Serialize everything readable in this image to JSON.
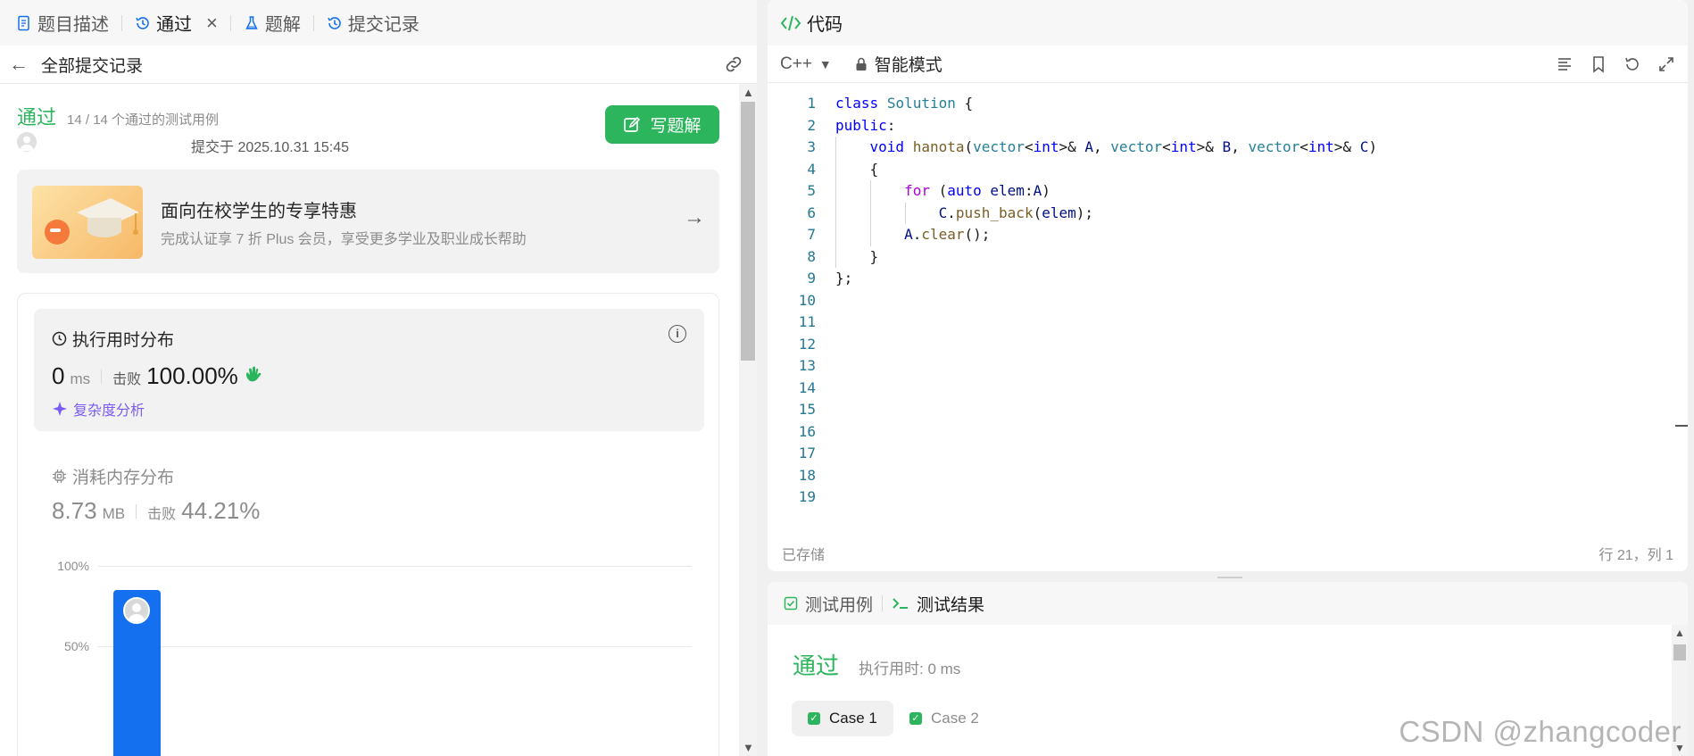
{
  "left": {
    "tabs": [
      {
        "label": "题目描述",
        "icon": "document-icon"
      },
      {
        "label": "通过",
        "icon": "history-icon",
        "active": true,
        "closable": true
      },
      {
        "label": "题解",
        "icon": "flask-icon"
      },
      {
        "label": "提交记录",
        "icon": "history-icon"
      }
    ],
    "back_label": "全部提交记录",
    "status": "通过",
    "status_detail": "14 / 14 个通过的测试用例",
    "submitted_at": "提交于 2025.10.31 15:45",
    "write_solution_label": "写题解",
    "promo": {
      "title": "面向在校学生的专享特惠",
      "subtitle": "完成认证享 7 折 Plus 会员，享受更多学业及职业成长帮助"
    },
    "runtime": {
      "title": "执行用时分布",
      "value": "0",
      "unit": "ms",
      "beat_label": "击败",
      "beat_value": "100.00%",
      "complexity_link": "复杂度分析"
    },
    "memory": {
      "title": "消耗内存分布",
      "value": "8.73",
      "unit": "MB",
      "beat_label": "击败",
      "beat_value": "44.21%"
    }
  },
  "chart_data": {
    "type": "bar",
    "y_ticks": [
      "100%",
      "50%"
    ],
    "ylim": [
      0,
      100
    ],
    "bars": [
      {
        "value": 85,
        "highlighted": true
      }
    ]
  },
  "code": {
    "title": "代码",
    "language": "C++",
    "mode": "智能模式",
    "line_numbers": [
      "1",
      "2",
      "3",
      "4",
      "5",
      "6",
      "7",
      "8",
      "9",
      "10",
      "11",
      "12",
      "13",
      "14",
      "15",
      "16",
      "17",
      "18",
      "19"
    ],
    "saved_status": "已存储",
    "cursor_position": "行 21，列 1"
  },
  "tests": {
    "tabs": [
      {
        "label": "测试用例"
      },
      {
        "label": "测试结果",
        "active": true
      }
    ],
    "result": "通过",
    "runtime_text": "执行用时: 0 ms",
    "cases": [
      "Case 1",
      "Case 2"
    ]
  },
  "watermark": "CSDN @zhangcoder",
  "colors": {
    "accent_green": "#2db55d",
    "bar_blue": "#1570ef",
    "complexity_purple": "#7c5cf0"
  }
}
